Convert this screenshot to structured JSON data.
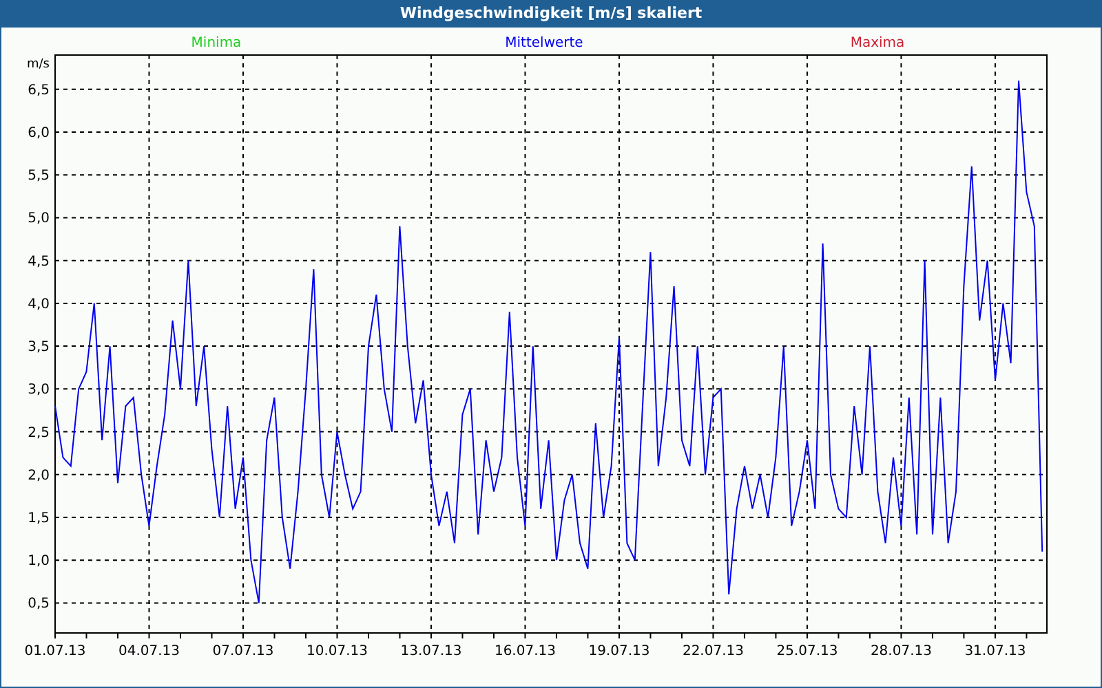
{
  "window": {
    "title": "Windgeschwindigkeit [m/s] skaliert"
  },
  "legend": [
    {
      "label": "Minima",
      "color": "#22cc22"
    },
    {
      "label": "Maxima",
      "color": "#cc2233"
    }
  ],
  "chart": {
    "chart_data": {
      "type": "line",
      "ylabel": "m/s",
      "grid": true,
      "ylim": [
        0.15,
        6.9
      ],
      "yticks": [
        {
          "value": 0.5,
          "label": "0,5"
        },
        {
          "value": 1,
          "label": "1,0"
        },
        {
          "value": 1.5,
          "label": "1,5"
        },
        {
          "value": 2,
          "label": "2,0"
        },
        {
          "value": 2.5,
          "label": "2,5"
        },
        {
          "value": 3,
          "label": "3,0"
        },
        {
          "value": 3.5,
          "label": "3,5"
        },
        {
          "value": 4,
          "label": "4,0"
        },
        {
          "value": 4.5,
          "label": "4,5"
        },
        {
          "value": 5,
          "label": "5,0"
        },
        {
          "value": 5.5,
          "label": "5,5"
        },
        {
          "value": 6,
          "label": "6,0"
        },
        {
          "value": 6.5,
          "label": "6,5"
        }
      ],
      "categories": [
        "01.07.13",
        null,
        null,
        null,
        null,
        null,
        null,
        null,
        null,
        null,
        null,
        null,
        "04.07.13",
        null,
        null,
        null,
        null,
        null,
        null,
        null,
        null,
        null,
        null,
        null,
        "07.07.13",
        null,
        null,
        null,
        null,
        null,
        null,
        null,
        null,
        null,
        null,
        null,
        "10.07.13",
        null,
        null,
        null,
        null,
        null,
        null,
        null,
        null,
        null,
        null,
        null,
        "13.07.13",
        null,
        null,
        null,
        null,
        null,
        null,
        null,
        null,
        null,
        null,
        null,
        "16.07.13",
        null,
        null,
        null,
        null,
        null,
        null,
        null,
        null,
        null,
        null,
        null,
        "19.07.13",
        null,
        null,
        null,
        null,
        null,
        null,
        null,
        null,
        null,
        null,
        null,
        "22.07.13",
        null,
        null,
        null,
        null,
        null,
        null,
        null,
        null,
        null,
        null,
        null,
        "25.07.13",
        null,
        null,
        null,
        null,
        null,
        null,
        null,
        null,
        null,
        null,
        null,
        "28.07.13",
        null,
        null,
        null,
        null,
        null,
        null,
        null,
        null,
        null,
        null,
        null,
        "31.07.13",
        null,
        null,
        null,
        null,
        null,
        null
      ],
      "series": [
        {
          "name": "Mittelwerte",
          "color": "#0000ee",
          "values": [
            2.8,
            2.2,
            2.1,
            3.0,
            3.2,
            4.0,
            2.4,
            3.5,
            1.9,
            2.8,
            2.9,
            2.0,
            1.4,
            2.1,
            2.7,
            3.8,
            3.0,
            4.5,
            2.8,
            3.5,
            2.3,
            1.5,
            2.8,
            1.6,
            2.2,
            1.0,
            0.5,
            2.4,
            2.9,
            1.5,
            0.9,
            1.8,
            3.0,
            4.4,
            2.0,
            1.5,
            2.5,
            2.0,
            1.6,
            1.8,
            3.5,
            4.1,
            3.0,
            2.5,
            4.9,
            3.5,
            2.6,
            3.1,
            2.0,
            1.4,
            1.8,
            1.2,
            2.7,
            3.0,
            1.3,
            2.4,
            1.8,
            2.2,
            3.9,
            2.2,
            1.4,
            3.5,
            1.6,
            2.4,
            1.0,
            1.7,
            2.0,
            1.2,
            0.9,
            2.6,
            1.5,
            2.1,
            3.6,
            1.2,
            1.0,
            2.8,
            4.6,
            2.1,
            2.9,
            4.2,
            2.4,
            2.1,
            3.5,
            2.0,
            2.9,
            3.0,
            0.6,
            1.6,
            2.1,
            1.6,
            2.0,
            1.5,
            2.2,
            3.5,
            1.4,
            1.8,
            2.4,
            1.6,
            4.7,
            2.0,
            1.6,
            1.5,
            2.8,
            2.0,
            3.5,
            1.8,
            1.2,
            2.2,
            1.4,
            2.9,
            1.3,
            4.5,
            1.3,
            2.9,
            1.2,
            1.8,
            4.2,
            5.6,
            3.8,
            4.5,
            3.1,
            4.0,
            3.3,
            6.6,
            5.3,
            4.9,
            1.1
          ]
        }
      ]
    }
  }
}
